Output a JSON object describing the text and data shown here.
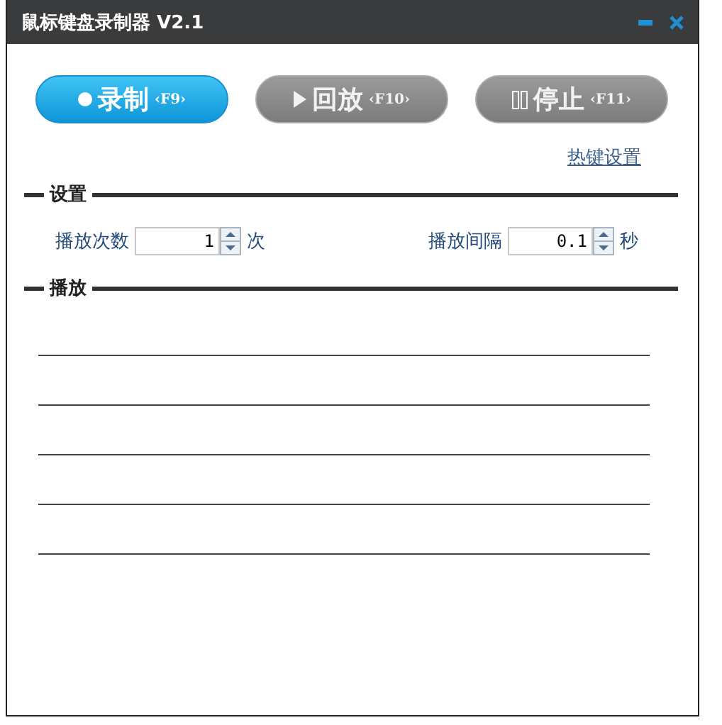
{
  "window": {
    "title": "鼠标键盘录制器 V2.1"
  },
  "buttons": [
    {
      "kind": "record",
      "label": "录制",
      "key": "‹F9›",
      "disabled": false
    },
    {
      "kind": "play",
      "label": "回放",
      "key": "‹F10›",
      "disabled": true
    },
    {
      "kind": "stop",
      "label": "停止",
      "key": "‹F11›",
      "disabled": true
    }
  ],
  "hotkey_link": "热键设置",
  "settings": {
    "title": "设置",
    "fields": [
      {
        "label": "播放次数",
        "value": "1",
        "unit": "次"
      },
      {
        "label": "播放间隔",
        "value": "0.1",
        "unit": "秒"
      }
    ]
  },
  "playback": {
    "title": "播放"
  }
}
